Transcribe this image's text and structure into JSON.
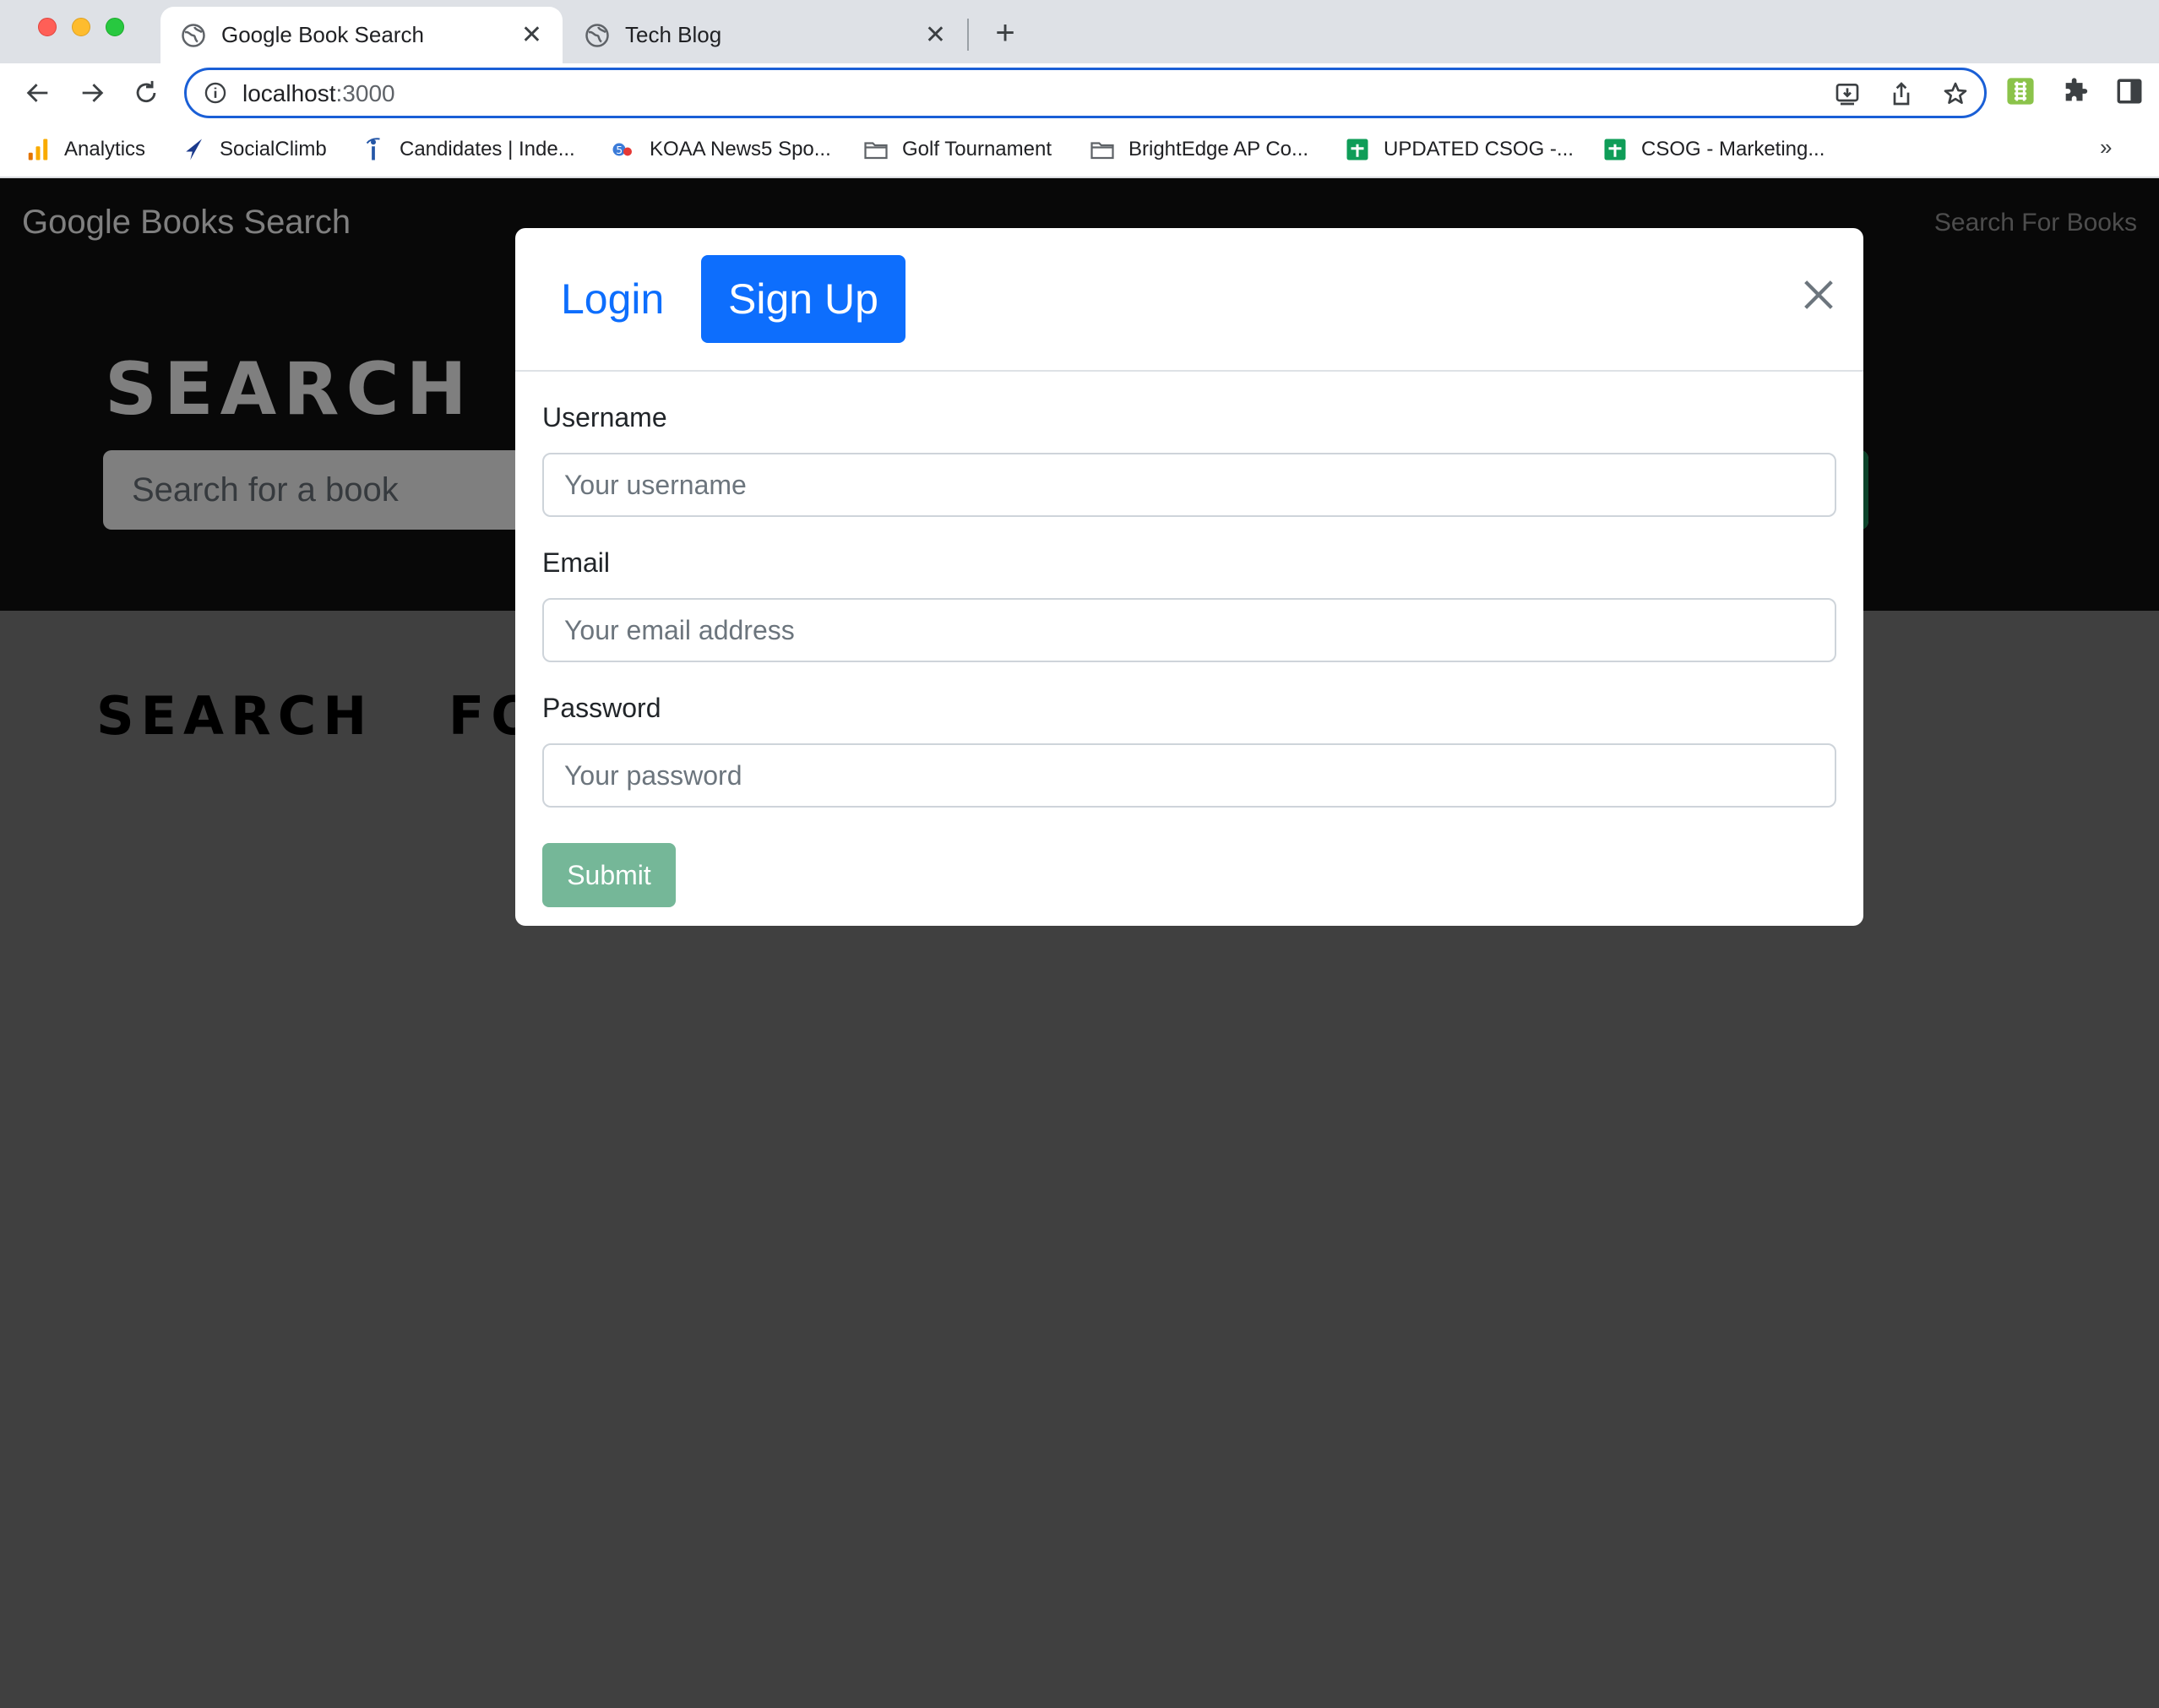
{
  "browser": {
    "tabs": [
      {
        "title": "Google Book Search",
        "active": true,
        "favicon": "globe-icon"
      },
      {
        "title": "Tech Blog",
        "active": false,
        "favicon": "globe-icon"
      }
    ],
    "new_tab": "+",
    "close_glyph": "✕",
    "url_host": "localhost",
    "url_port": ":3000",
    "bookmarks_more": "»"
  },
  "bookmarks": [
    {
      "label": "Analytics",
      "icon": "analytics-icon"
    },
    {
      "label": "SocialClimb",
      "icon": "socialclimb-icon"
    },
    {
      "label": "Candidates | Inde...",
      "icon": "indeed-icon"
    },
    {
      "label": "KOAA News5 Spo...",
      "icon": "koaa-icon"
    },
    {
      "label": "Golf Tournament",
      "icon": "folder-icon"
    },
    {
      "label": "BrightEdge AP Co...",
      "icon": "folder-icon"
    },
    {
      "label": "UPDATED CSOG -...",
      "icon": "sheets-icon"
    },
    {
      "label": "CSOG - Marketing...",
      "icon": "sheets-icon"
    }
  ],
  "site": {
    "brand": "Google Books Search",
    "nav_link": "Search For Books",
    "hero_title": "SEARCH",
    "search_placeholder": "Search for a book",
    "results_title": "SEARCH   FO"
  },
  "modal": {
    "tab_login": "Login",
    "tab_signup": "Sign Up",
    "fields": [
      {
        "label": "Username",
        "placeholder": "Your username"
      },
      {
        "label": "Email",
        "placeholder": "Your email address"
      },
      {
        "label": "Password",
        "placeholder": "Your password"
      }
    ],
    "submit": "Submit"
  },
  "colors": {
    "primary": "#0d6efd",
    "submit_disabled": "#75b798",
    "header_bg": "#111111",
    "backdrop": "#808080"
  }
}
